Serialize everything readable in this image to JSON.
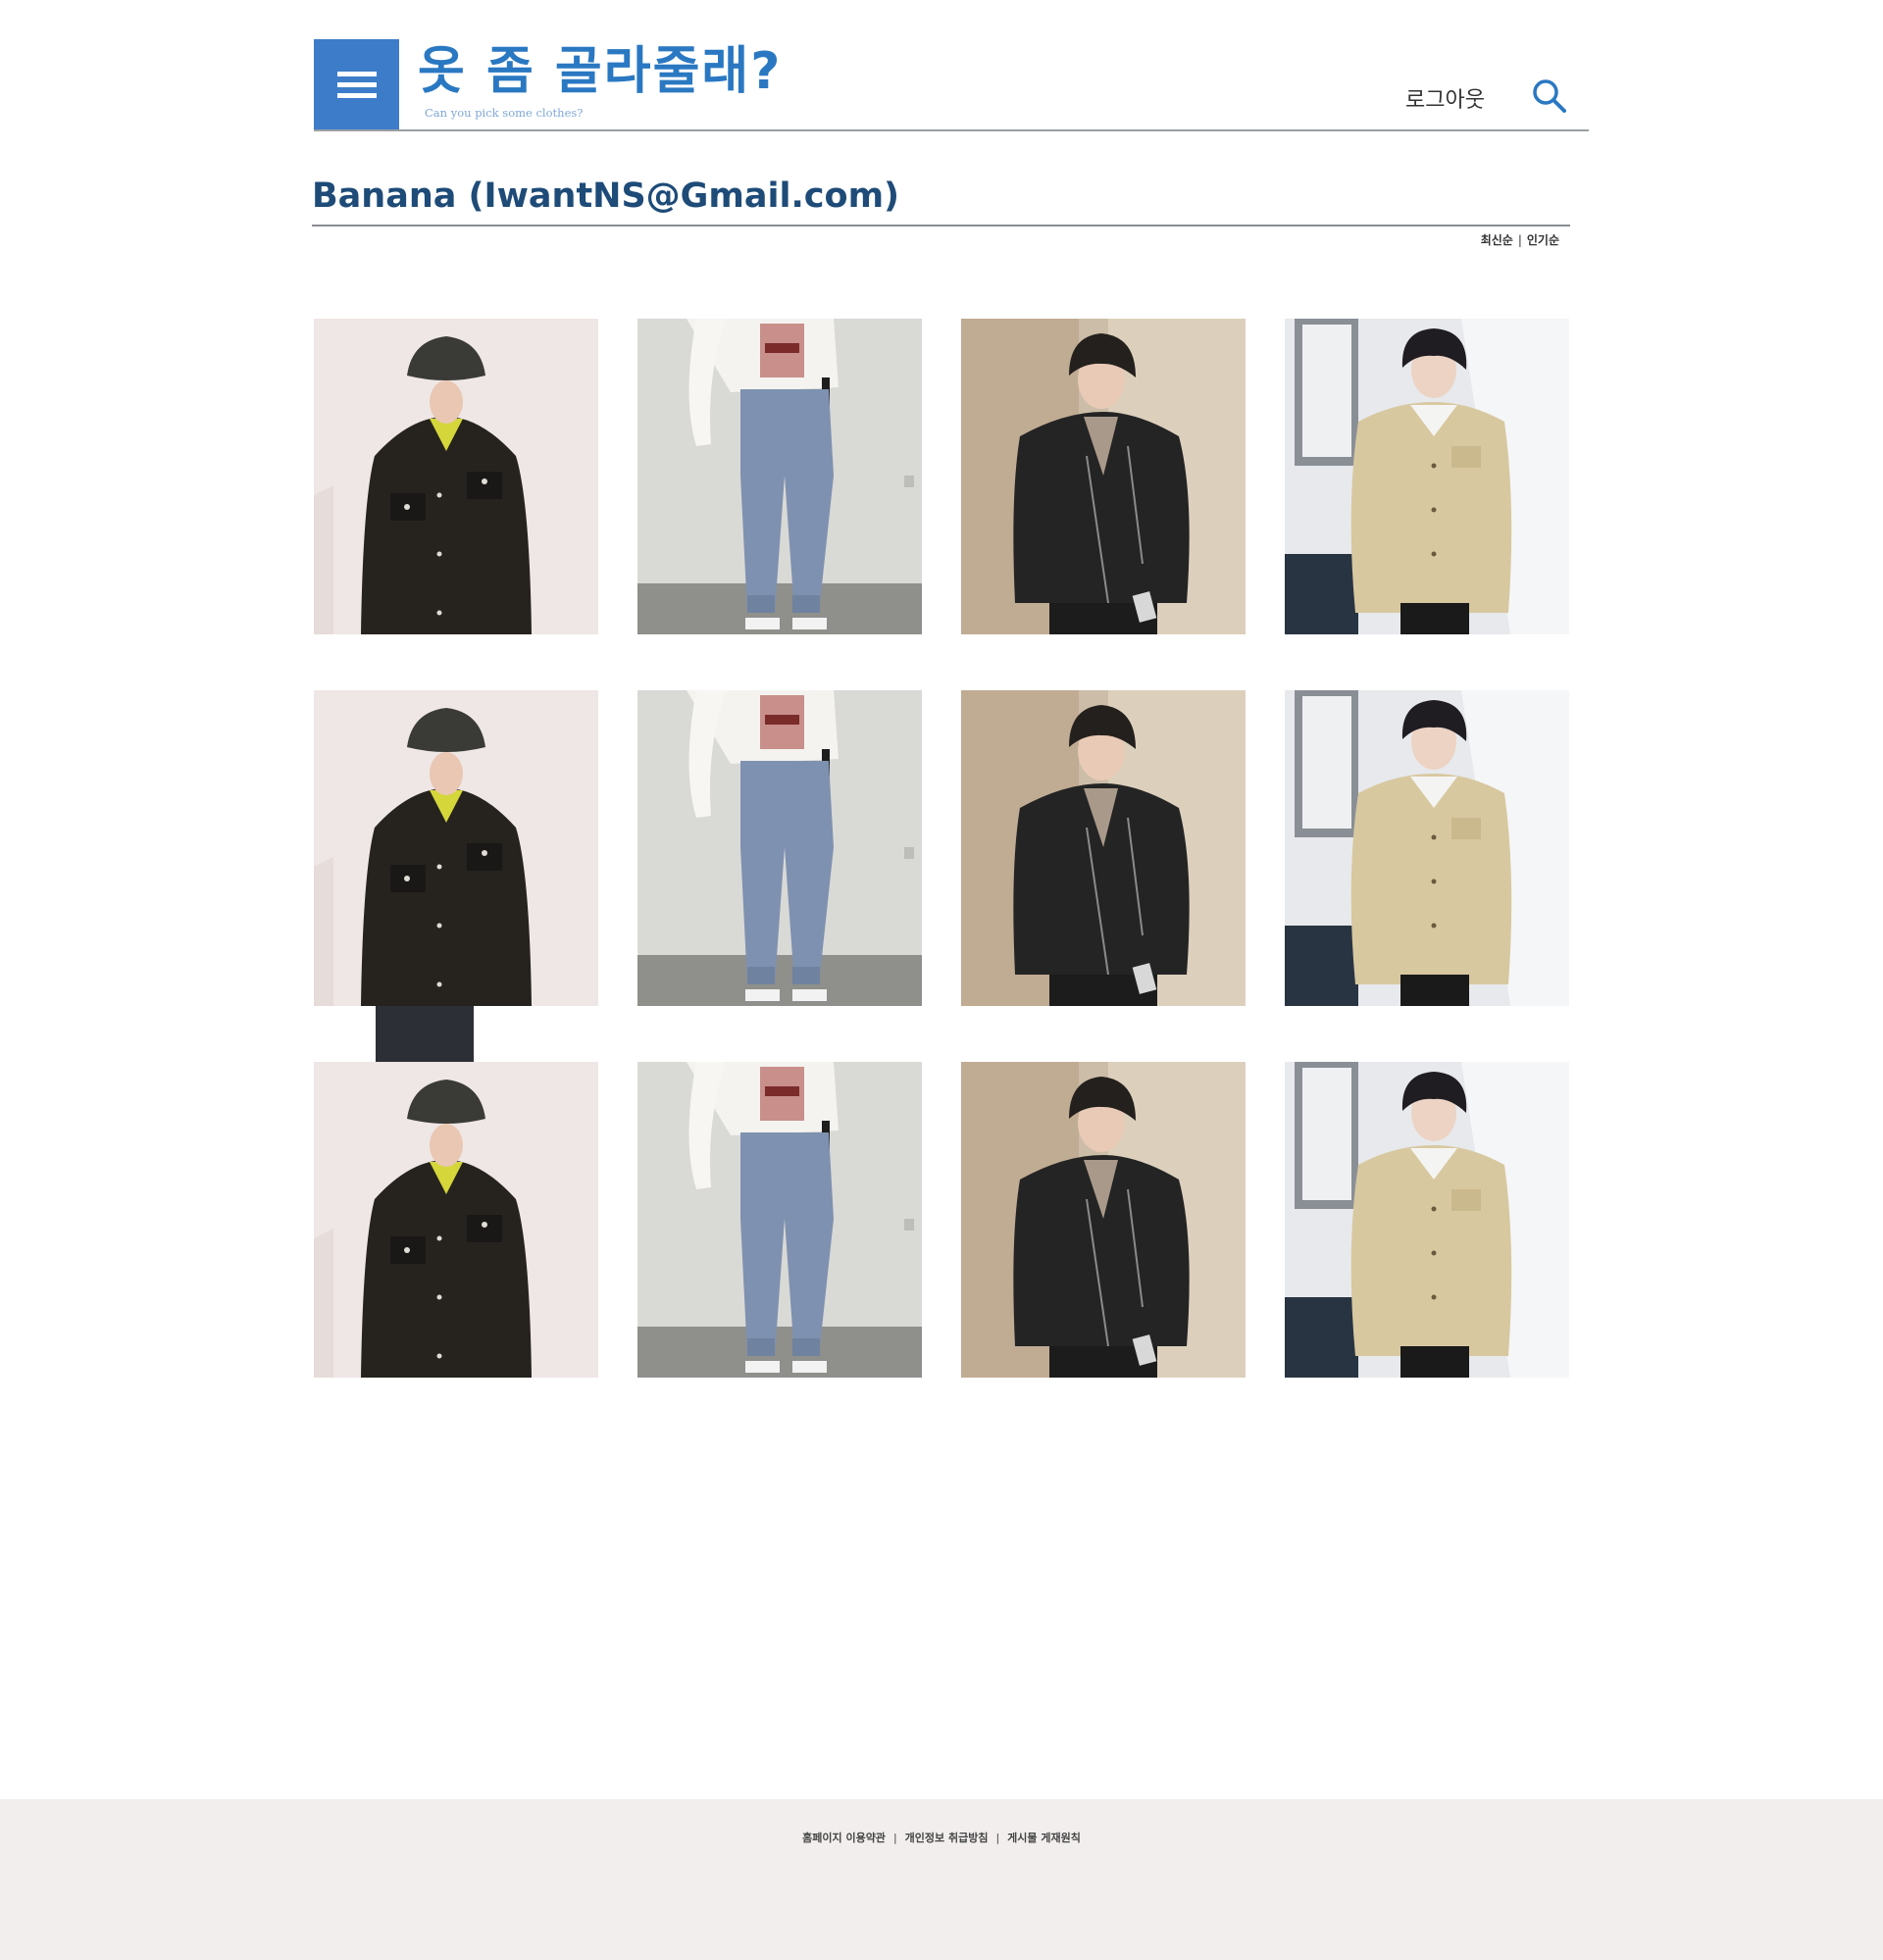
{
  "header": {
    "menu_icon": "hamburger-menu-icon",
    "logo_title": "옷 좀 골라줄래?",
    "logo_subtitle": "Can you pick some clothes?",
    "logout_label": "로그아웃",
    "search_icon": "search-icon"
  },
  "profile": {
    "title": "Banana  (IwantNS@Gmail.com)"
  },
  "sort": {
    "latest_label": "최신순",
    "separator": "|",
    "popular_label": "인기순"
  },
  "grid": {
    "rows": 3,
    "columns": 4,
    "items": [
      {
        "style": "black-shirt-jacket-bucket-hat"
      },
      {
        "style": "wide-blue-jeans-white-sweatshirt"
      },
      {
        "style": "black-leather-rider-jacket"
      },
      {
        "style": "beige-trucker-jacket"
      }
    ]
  },
  "colors": {
    "brand_blue": "#2a78c2",
    "menu_blue": "#3d7cc9",
    "title_navy": "#1e4b78",
    "footer_bg": "#f1eeed"
  },
  "footer": {
    "links": [
      "홈페이지 이용약관",
      "개인정보 취급방침",
      "게시물 게재원칙"
    ],
    "separator": "|"
  }
}
